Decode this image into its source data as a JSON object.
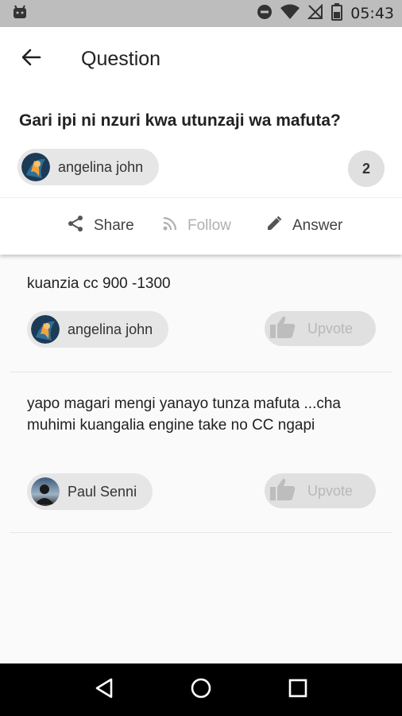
{
  "status_bar": {
    "time": "05:43"
  },
  "app_bar": {
    "title": "Question"
  },
  "question": {
    "title": "Gari ipi ni nzuri kwa utunzaji wa mafuta?",
    "author": "angelina john",
    "answer_count": "2"
  },
  "actions": {
    "share": "Share",
    "follow": "Follow",
    "answer": "Answer"
  },
  "answers": [
    {
      "text": "kuanzia cc 900 -1300",
      "author": "angelina john",
      "upvote": "Upvote"
    },
    {
      "text": "yapo magari mengi yanayo tunza mafuta ...cha muhimi kuangalia engine take no CC ngapi",
      "author": "Paul Senni",
      "upvote": "Upvote"
    }
  ],
  "colors": {
    "status_bar": "#bdbdbd",
    "nav_bar": "#000000",
    "disabled": "#b0b0b0"
  }
}
